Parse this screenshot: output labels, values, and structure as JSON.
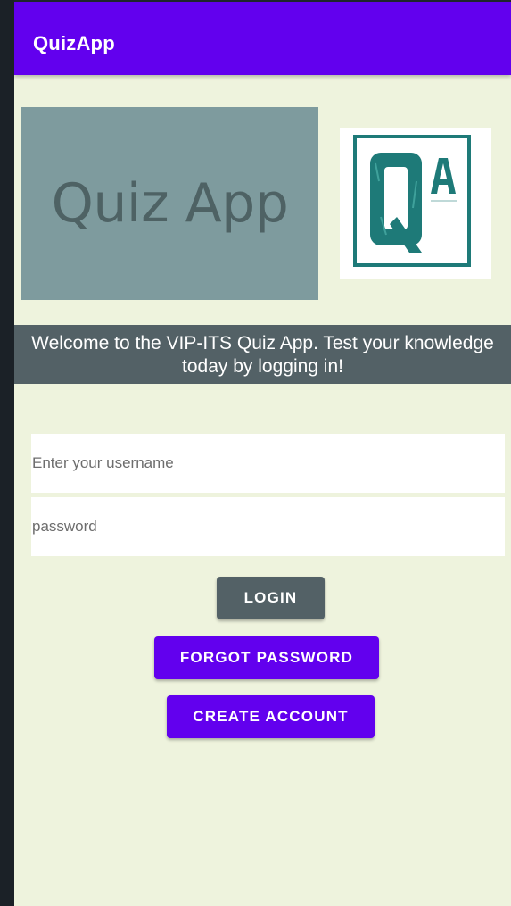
{
  "app": {
    "title": "QuizApp"
  },
  "hero": {
    "text": "Quiz App"
  },
  "logo": {
    "letters": "QA",
    "color": "#1e7a78"
  },
  "welcome": {
    "text": "Welcome to the VIP-ITS Quiz App. Test your knowledge today by logging in!"
  },
  "form": {
    "username": {
      "value": "",
      "placeholder": "Enter your username"
    },
    "password": {
      "value": "",
      "placeholder": "password"
    }
  },
  "buttons": {
    "login": "LOGIN",
    "forgot_password": "FORGOT PASSWORD",
    "create_account": "CREATE ACCOUNT"
  },
  "colors": {
    "primary": "#6200ee",
    "secondary": "#536166",
    "background": "#eef3dd",
    "hero_bg": "#7e9b9e"
  }
}
